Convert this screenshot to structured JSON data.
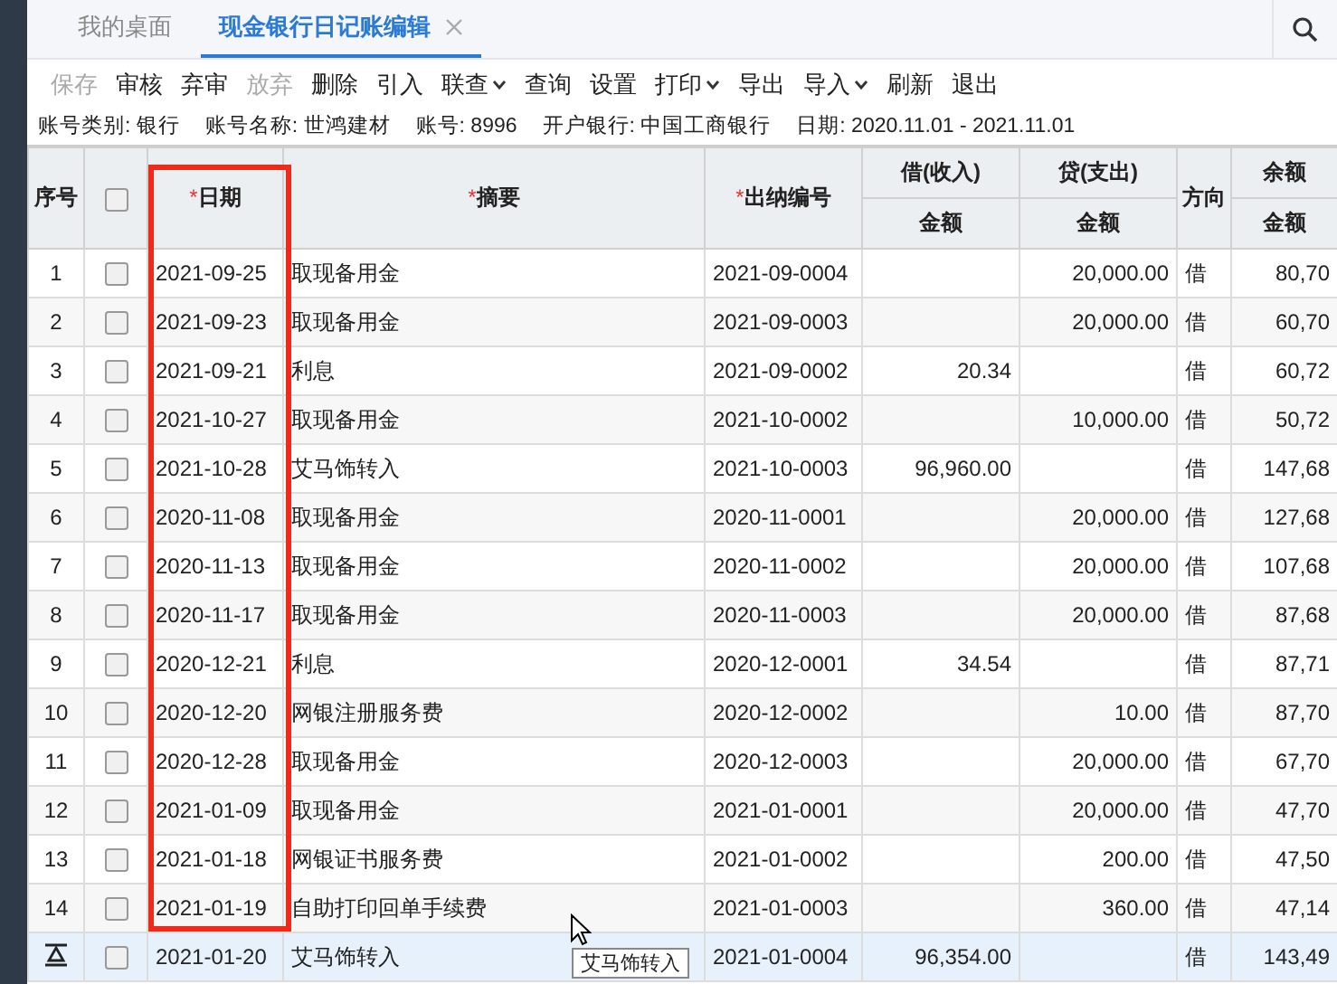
{
  "tabs": [
    {
      "label": "我的桌面",
      "selected": false,
      "closable": false
    },
    {
      "label": "现金银行日记账编辑",
      "selected": true,
      "closable": true
    }
  ],
  "toolbar": [
    {
      "label": "保存",
      "disabled": true,
      "dropdown": false
    },
    {
      "label": "审核",
      "disabled": false,
      "dropdown": false
    },
    {
      "label": "弃审",
      "disabled": false,
      "dropdown": false
    },
    {
      "label": "放弃",
      "disabled": true,
      "dropdown": false
    },
    {
      "label": "删除",
      "disabled": false,
      "dropdown": false
    },
    {
      "label": "引入",
      "disabled": false,
      "dropdown": false
    },
    {
      "label": "联查",
      "disabled": false,
      "dropdown": true
    },
    {
      "label": "查询",
      "disabled": false,
      "dropdown": false
    },
    {
      "label": "设置",
      "disabled": false,
      "dropdown": false
    },
    {
      "label": "打印",
      "disabled": false,
      "dropdown": true
    },
    {
      "label": "导出",
      "disabled": false,
      "dropdown": false
    },
    {
      "label": "导入",
      "disabled": false,
      "dropdown": true
    },
    {
      "label": "刷新",
      "disabled": false,
      "dropdown": false
    },
    {
      "label": "退出",
      "disabled": false,
      "dropdown": false
    }
  ],
  "info": [
    "账号类别: 银行",
    "账号名称: 世鸿建材",
    "账号: 8996",
    "开户银行: 中国工商银行",
    "日期: 2020.11.01 - 2021.11.01"
  ],
  "table": {
    "columns": [
      {
        "label": "序号"
      },
      {
        "kind": "check",
        "checked": false
      },
      {
        "label": "日期",
        "mark": "*"
      },
      {
        "label": "摘要",
        "mark": "*"
      },
      {
        "label": "出纳编号",
        "mark": "*"
      },
      {
        "label": "借(收入)",
        "sub": "金额"
      },
      {
        "label": "贷(支出)",
        "sub": "金额"
      },
      {
        "label": "方向"
      },
      {
        "label": "余额",
        "sub": "金额"
      }
    ],
    "rows": [
      {
        "no": "1",
        "checked": false,
        "selected": false,
        "date": "2021-09-25",
        "summary": "取现备用金",
        "code": "2021-09-0004",
        "credit": "20,000.00",
        "dir": "借",
        "balance": "80,70"
      },
      {
        "no": "2",
        "checked": false,
        "selected": false,
        "date": "2021-09-23",
        "summary": "取现备用金",
        "code": "2021-09-0003",
        "credit": "20,000.00",
        "dir": "借",
        "balance": "60,70"
      },
      {
        "no": "3",
        "checked": false,
        "selected": false,
        "date": "2021-09-21",
        "summary": "利息",
        "code": "2021-09-0002",
        "debit": "20.34",
        "dir": "借",
        "balance": "60,72"
      },
      {
        "no": "4",
        "checked": false,
        "selected": false,
        "date": "2021-10-27",
        "summary": "取现备用金",
        "code": "2021-10-0002",
        "credit": "10,000.00",
        "dir": "借",
        "balance": "50,72"
      },
      {
        "no": "5",
        "checked": false,
        "selected": false,
        "date": "2021-10-28",
        "summary": "艾马饰转入",
        "code": "2021-10-0003",
        "debit": "96,960.00",
        "dir": "借",
        "balance": "147,68"
      },
      {
        "no": "6",
        "checked": false,
        "selected": false,
        "date": "2020-11-08",
        "summary": "取现备用金",
        "code": "2020-11-0001",
        "credit": "20,000.00",
        "dir": "借",
        "balance": "127,68"
      },
      {
        "no": "7",
        "checked": false,
        "selected": false,
        "date": "2020-11-13",
        "summary": "取现备用金",
        "code": "2020-11-0002",
        "credit": "20,000.00",
        "dir": "借",
        "balance": "107,68"
      },
      {
        "no": "8",
        "checked": false,
        "selected": false,
        "date": "2020-11-17",
        "summary": "取现备用金",
        "code": "2020-11-0003",
        "credit": "20,000.00",
        "dir": "借",
        "balance": "87,68"
      },
      {
        "no": "9",
        "checked": false,
        "selected": false,
        "date": "2020-12-21",
        "summary": "利息",
        "code": "2020-12-0001",
        "debit": "34.54",
        "dir": "借",
        "balance": "87,71"
      },
      {
        "no": "10",
        "checked": false,
        "selected": false,
        "date": "2020-12-20",
        "summary": "网银注册服务费",
        "code": "2020-12-0002",
        "credit": "10.00",
        "dir": "借",
        "balance": "87,70"
      },
      {
        "no": "11",
        "checked": false,
        "selected": false,
        "date": "2020-12-28",
        "summary": "取现备用金",
        "code": "2020-12-0003",
        "credit": "20,000.00",
        "dir": "借",
        "balance": "67,70"
      },
      {
        "no": "12",
        "checked": false,
        "selected": false,
        "date": "2021-01-09",
        "summary": "取现备用金",
        "code": "2021-01-0001",
        "credit": "20,000.00",
        "dir": "借",
        "balance": "47,70"
      },
      {
        "no": "13",
        "checked": false,
        "selected": false,
        "date": "2021-01-18",
        "summary": "网银证书服务费",
        "code": "2021-01-0002",
        "credit": "200.00",
        "dir": "借",
        "balance": "47,50"
      },
      {
        "no": "14",
        "checked": false,
        "selected": false,
        "date": "2021-01-19",
        "summary": "自助打印回单手续费",
        "code": "2021-01-0003",
        "credit": "360.00",
        "dir": "借",
        "balance": "47,14"
      },
      {
        "checked": false,
        "selected": true,
        "date": "2021-01-20",
        "summary": "艾马饰转入",
        "code": "2021-01-0004",
        "debit": "96,354.00",
        "dir": "借",
        "balance": "143,49"
      }
    ]
  },
  "tooltip": {
    "text": "艾马饰转入"
  }
}
